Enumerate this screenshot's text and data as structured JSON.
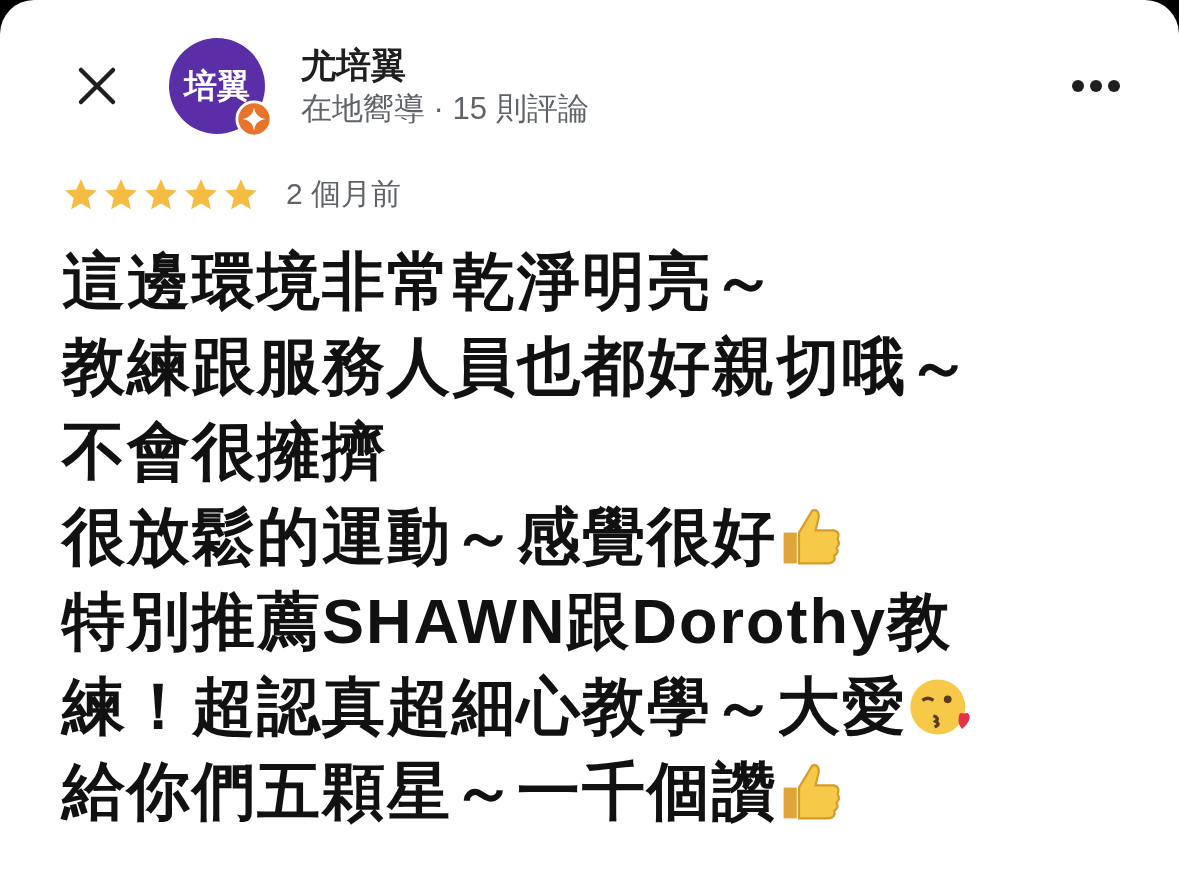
{
  "header": {
    "avatar_text": "培翼",
    "name": "尤培翼",
    "subtitle": "在地嚮導 · 15 則評論",
    "local_guide": true
  },
  "review": {
    "stars": 5,
    "time": "2 個月前",
    "lines": [
      {
        "kind": "plain",
        "text": "這邊環境非常乾淨明亮～"
      },
      {
        "kind": "plain",
        "text": "教練跟服務人員也都好親切哦～"
      },
      {
        "kind": "plain",
        "text": "不會很擁擠"
      },
      {
        "kind": "thumbs",
        "text": "很放鬆的運動～感覺很好"
      },
      {
        "kind": "plain",
        "text": "特別推薦SHAWN跟Dorothy教"
      },
      {
        "kind": "kiss",
        "text": "練！超認真超細心教學～大愛"
      },
      {
        "kind": "thumbs",
        "text": "給你們五顆星～一千個讚"
      }
    ]
  }
}
